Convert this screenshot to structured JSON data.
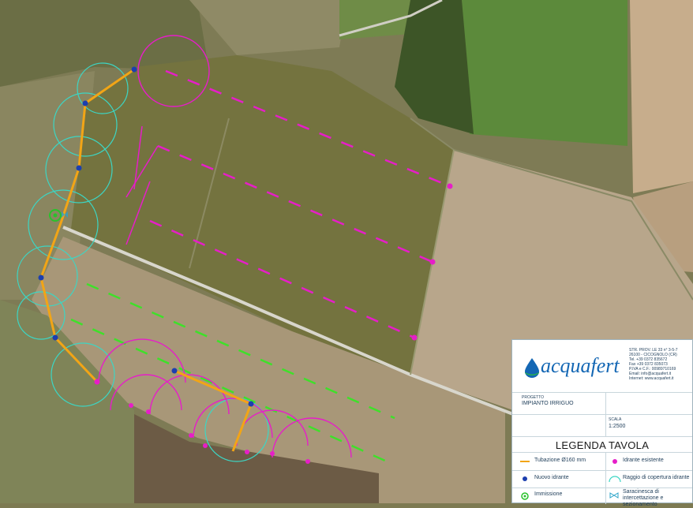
{
  "colors": {
    "pipe": "#f2a516",
    "new_hydrant": "#1c3faf",
    "existing_hydrant": "#e61ec8",
    "coverage_radius": "#3cd6c4",
    "existing_line": "#e61ec8",
    "green_line": "#3fe02a",
    "immission": "#29c22b",
    "valve": "#2aa3c8",
    "brand": "#1467b4"
  },
  "company": {
    "logo_text": "acquafert",
    "logo_icon": "water-drop-icon",
    "address_lines": [
      "STR. PROV. LE 33 n° 3-5-7",
      "26100 - CICOGNOLO (CR)",
      "Tel. +39 0372 835672",
      "Fax +39 0372 835073",
      "P.IVA e C.F.: 00989710169",
      "Email: info@acquafert.it",
      "Internet: www.acquafert.it"
    ]
  },
  "title_block": {
    "project_label": "PROGETTO",
    "project_value": "IMPIANTO IRRIGUO",
    "scale_label": "SCALA",
    "scale_value": "1:2500",
    "legend_title": "LEGENDA TAVOLA"
  },
  "legend": [
    {
      "symbol": "pipe-line-icon",
      "label": "Tubazione Ø160 mm"
    },
    {
      "symbol": "existing-hydrant-icon",
      "label": "Idrante esistente"
    },
    {
      "symbol": "new-hydrant-icon",
      "label": "Nuovo idrante"
    },
    {
      "symbol": "coverage-arc-icon",
      "label": "Raggio di copertura idrante"
    },
    {
      "symbol": "immission-icon",
      "label": "Immissione"
    },
    {
      "symbol": "valve-icon",
      "label": "Saracinesca di intercettazione e sezionamento"
    }
  ]
}
